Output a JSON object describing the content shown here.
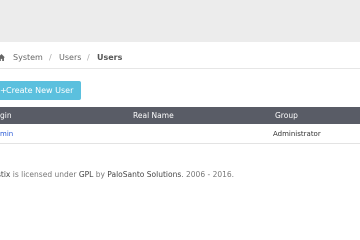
{
  "breadcrumb": {
    "items": [
      "System",
      "Users",
      "Users"
    ],
    "separator": "/"
  },
  "actions": {
    "create_label": "Create New User"
  },
  "table": {
    "columns": [
      "gin",
      "Real Name",
      "Group"
    ],
    "rows": [
      {
        "login": "min",
        "real_name": "",
        "group": "Administrator"
      }
    ]
  },
  "footer": {
    "product": "stix",
    "text1": " is licensed under ",
    "license": "GPL",
    "text2": " by ",
    "company": "PaloSanto Solutions",
    "years": ". 2006 - 2016."
  },
  "colors": {
    "accent": "#5bc0de",
    "header_bg": "#595c66",
    "link": "#2a5bd7"
  }
}
